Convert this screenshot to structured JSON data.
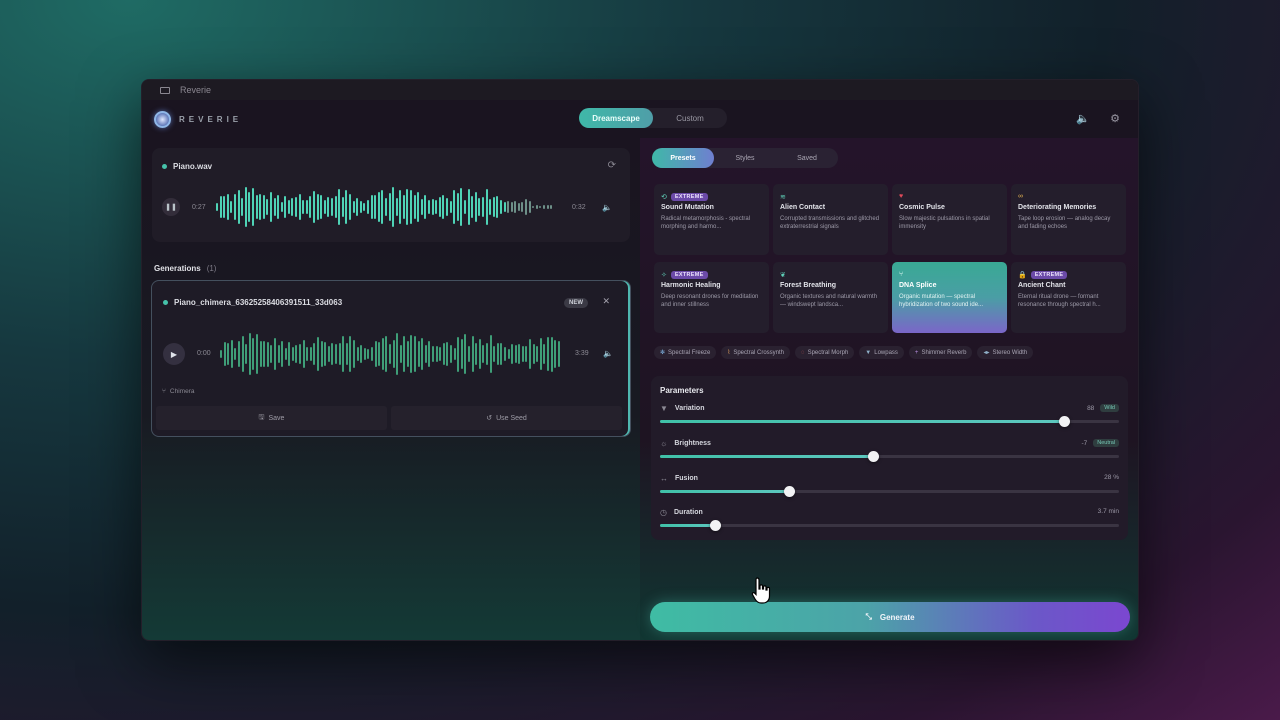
{
  "window": {
    "title": "Reverie"
  },
  "app": {
    "logo_text": "REVERIE"
  },
  "mode_toggle": {
    "options": [
      "Dreamscape",
      "Custom"
    ],
    "active": "Dreamscape"
  },
  "source": {
    "filename": "Piano.wav",
    "current_time": "0:27",
    "total_time": "0:32",
    "playing": true
  },
  "generations": {
    "header": "Generations",
    "count": "(1)",
    "items": [
      {
        "name": "Piano_chimera_63625258406391511_33d063",
        "badge": "NEW",
        "current_time": "0:00",
        "total_time": "3:39",
        "mode": "Chimera",
        "save_label": "Save",
        "use_seed_label": "Use Seed"
      }
    ]
  },
  "library_tabs": {
    "options": [
      "Presets",
      "Styles",
      "Saved"
    ],
    "active": "Presets"
  },
  "presets": [
    {
      "name": "Sound Mutation",
      "badge": "EXTREME",
      "icon": "mutation-icon",
      "desc": "Radical metamorphosis - spectral morphing and harmo..."
    },
    {
      "name": "Alien Contact",
      "badge": "",
      "icon": "signal-icon",
      "desc": "Corrupted transmissions and glitched extraterrestrial signals"
    },
    {
      "name": "Cosmic Pulse",
      "badge": "",
      "icon": "heart-icon",
      "desc": "Slow majestic pulsations in spatial immensity"
    },
    {
      "name": "Deteriorating Memories",
      "badge": "",
      "icon": "tape-icon",
      "desc": "Tape loop erosion — analog decay and fading echoes"
    },
    {
      "name": "Harmonic Healing",
      "badge": "EXTREME",
      "icon": "sparkle-icon",
      "desc": "Deep resonant drones for meditation and inner stillness"
    },
    {
      "name": "Forest Breathing",
      "badge": "",
      "icon": "leaf-icon",
      "desc": "Organic textures and natural warmth — windswept landsca..."
    },
    {
      "name": "DNA Splice",
      "badge": "",
      "icon": "split-icon",
      "desc": "Organic mutation — spectral hybridization of two sound ide...",
      "selected": true
    },
    {
      "name": "Ancient Chant",
      "badge": "EXTREME",
      "icon": "lock-icon",
      "desc": "Eternal ritual drone — formant resonance through spectral h..."
    }
  ],
  "effect_chips": [
    {
      "label": "Spectral Freeze",
      "icon": "snowflake-icon",
      "color": "#7fb2e0"
    },
    {
      "label": "Spectral Crossynth",
      "icon": "bracket-icon",
      "color": "#e0a060"
    },
    {
      "label": "Spectral Morph",
      "icon": "circle-icon",
      "color": "#e05a5a"
    },
    {
      "label": "Lowpass",
      "icon": "filter-icon",
      "color": "#8fb0c8"
    },
    {
      "label": "Shimmer Reverb",
      "icon": "plus-icon",
      "color": "#b88fe0"
    },
    {
      "label": "Stereo Width",
      "icon": "width-icon",
      "color": "#8fb0c8"
    }
  ],
  "parameters": {
    "title": "Parameters",
    "items": [
      {
        "label": "Variation",
        "icon": "filter-icon",
        "value_text": "88",
        "tag": "Wild",
        "level": 0.88
      },
      {
        "label": "Brightness",
        "icon": "sun-icon",
        "value_text": "-7",
        "tag": "Neutral",
        "level": 0.465
      },
      {
        "label": "Fusion",
        "icon": "arrows-icon",
        "value_text": "28 %",
        "tag": "",
        "level": 0.28
      },
      {
        "label": "Duration",
        "icon": "clock-icon",
        "value_text": "3.7 min",
        "tag": "",
        "level": 0.12
      }
    ]
  },
  "generate_label": "Generate",
  "colors": {
    "accent": "#46c2aa",
    "purple": "#7b47d0"
  }
}
